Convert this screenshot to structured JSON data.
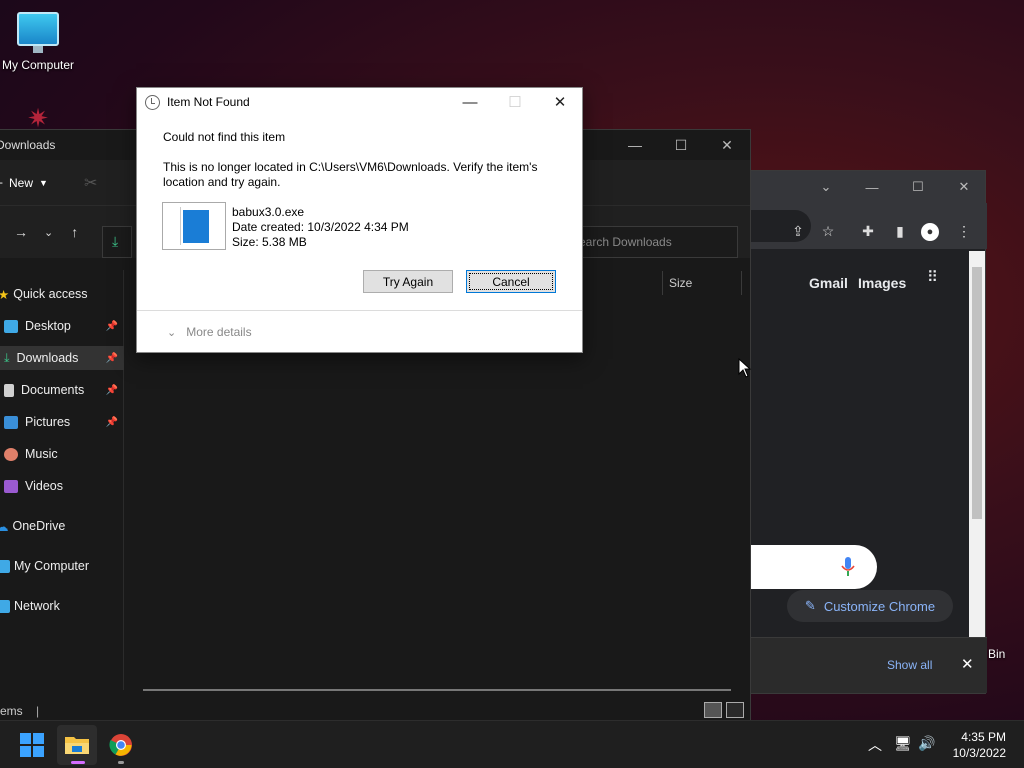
{
  "desktop": {
    "icons": [
      {
        "label": "My Computer"
      },
      {
        "label": "Bin"
      }
    ]
  },
  "explorer": {
    "title": "Downloads",
    "toolbar": {
      "new_label": "New"
    },
    "search_placeholder": "earch Downloads",
    "nav": [
      {
        "label": "Quick access",
        "pinned": false
      },
      {
        "label": "Desktop",
        "pinned": true
      },
      {
        "label": "Downloads",
        "pinned": true
      },
      {
        "label": "Documents",
        "pinned": true
      },
      {
        "label": "Pictures",
        "pinned": true
      },
      {
        "label": "Music",
        "pinned": false
      },
      {
        "label": "Videos",
        "pinned": false
      },
      {
        "label": "OneDrive",
        "pinned": false
      },
      {
        "label": "My Computer",
        "pinned": false
      },
      {
        "label": "Network",
        "pinned": false
      }
    ],
    "column_size": "Size",
    "status": "ems"
  },
  "chrome": {
    "links": {
      "gmail": "Gmail",
      "images": "Images"
    },
    "customize_label": "Customize Chrome",
    "downloads_bar": {
      "show_all": "Show all"
    }
  },
  "dialog": {
    "title": "Item Not Found",
    "heading": "Could not find this item",
    "message": "This is no longer located in C:\\Users\\VM6\\Downloads. Verify the item's location and try again.",
    "file": {
      "name": "babux3.0.exe",
      "date_created": "Date created: 10/3/2022 4:34 PM",
      "size": "Size: 5.38 MB"
    },
    "buttons": {
      "try_again": "Try Again",
      "cancel": "Cancel"
    },
    "more_details": "More details"
  },
  "taskbar": {
    "time": "4:35 PM",
    "date": "10/3/2022"
  }
}
